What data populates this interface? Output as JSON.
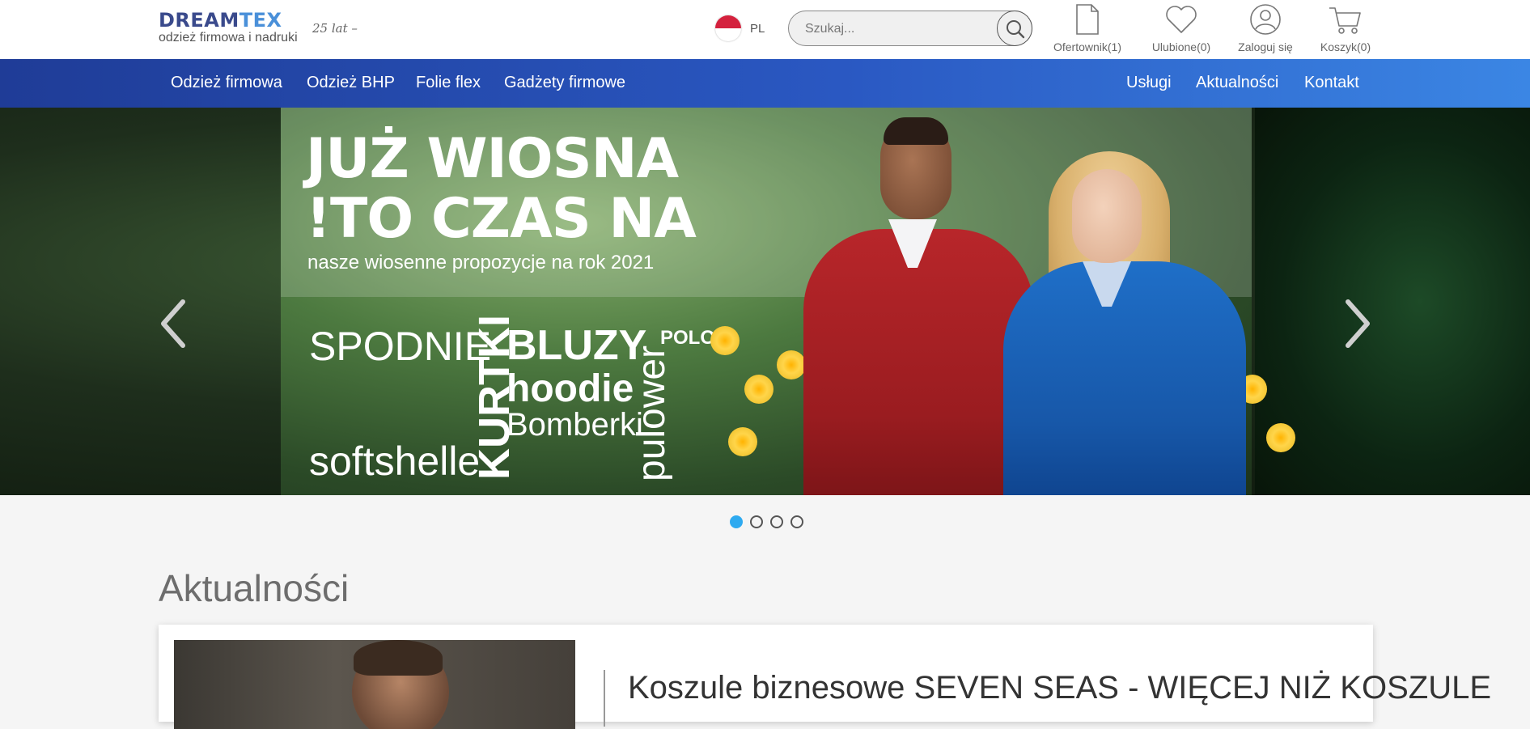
{
  "header": {
    "logo": {
      "brand_part1": "DREAM",
      "brand_part2": "TEX",
      "tagline": "odzież firmowa i nadruki",
      "badge": "25 lat –"
    },
    "language": {
      "code": "PL",
      "flag": "poland-flag"
    },
    "search": {
      "placeholder": "Szukaj...",
      "value": ""
    },
    "icons": [
      {
        "name": "offer-icon",
        "label": "Ofertownik(1)"
      },
      {
        "name": "heart-icon",
        "label": "Ulubione(0)"
      },
      {
        "name": "user-icon",
        "label": "Zaloguj się"
      },
      {
        "name": "cart-icon",
        "label": "Koszyk(0)"
      }
    ]
  },
  "nav": {
    "left": [
      "Odzież firmowa",
      "Odzież BHP",
      "Folie flex",
      "Gadżety firmowe"
    ],
    "right": [
      "Usługi",
      "Aktualności",
      "Kontakt"
    ]
  },
  "hero": {
    "headline1": "JUŻ WIOSNA",
    "headline2": "!TO CZAS NA",
    "subline": "nasze wiosenne propozycje na rok 2021",
    "words": {
      "spodnie": "SPODNIE",
      "kurtki": "KURTKI",
      "bluzy": "BLUZY",
      "hoodie": "hoodie",
      "bomberki": "Bomberki",
      "pulower": "pulower",
      "polo": "POLO",
      "softshelle": "softshelle"
    },
    "slides_total": 4,
    "active_slide": 1
  },
  "news": {
    "section_title": "Aktualności",
    "first_article_title": "Koszule biznesowe SEVEN SEAS - WIĘCEJ NIŻ KOSZULE"
  },
  "colors": {
    "nav_gradient_start": "#1f3c97",
    "nav_gradient_end": "#3b86e4",
    "dot_active": "#2eaaf0",
    "brand_dark": "#3a4a8c",
    "brand_light": "#4a90d9"
  }
}
